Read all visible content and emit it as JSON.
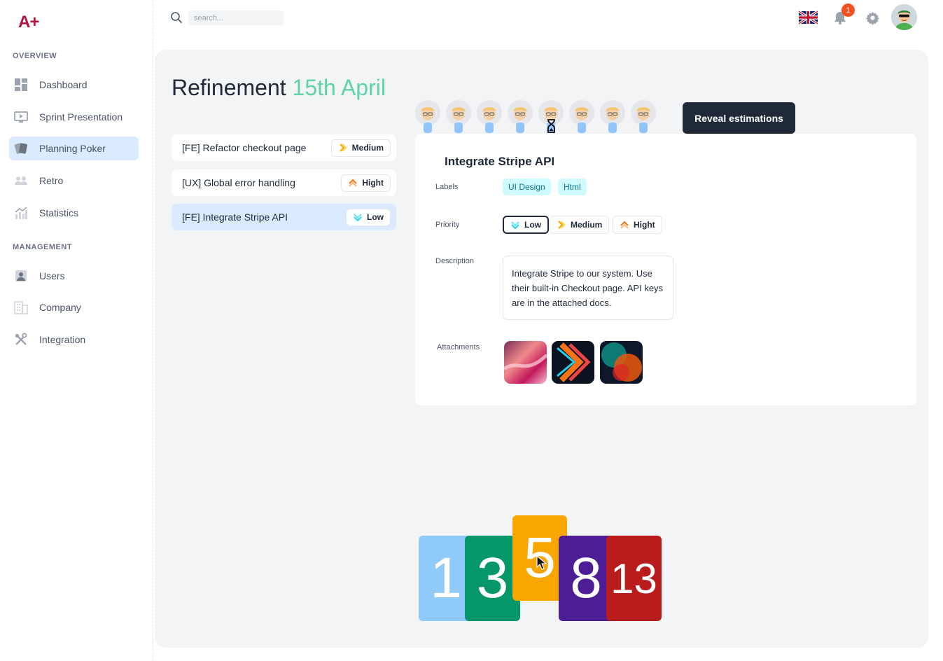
{
  "app": {
    "logo": "A+"
  },
  "sidebar": {
    "sections": [
      {
        "title": "OVERVIEW"
      },
      {
        "title": "MANAGEMENT"
      }
    ],
    "items": [
      {
        "label": "Dashboard",
        "icon": "dashboard-icon"
      },
      {
        "label": "Sprint Presentation",
        "icon": "presentation-icon"
      },
      {
        "label": "Planning Poker",
        "icon": "cards-icon",
        "active": true
      },
      {
        "label": "Retro",
        "icon": "people-icon"
      },
      {
        "label": "Statistics",
        "icon": "chart-icon"
      },
      {
        "label": "Users",
        "icon": "user-icon"
      },
      {
        "label": "Company",
        "icon": "building-icon"
      },
      {
        "label": "Integration",
        "icon": "tools-icon"
      }
    ]
  },
  "topbar": {
    "search_placeholder": "search...",
    "notification_count": "1",
    "language": "en-GB"
  },
  "page": {
    "title": "Refinement",
    "date": "15th April"
  },
  "tasks": [
    {
      "name": "[FE] Refactor checkout page",
      "priority": "Medium"
    },
    {
      "name": "[UX] Global error handling",
      "priority": "Hight"
    },
    {
      "name": "[FE] Integrate Stripe API",
      "priority": "Low",
      "selected": true
    }
  ],
  "voters": {
    "count": 8,
    "pending_index": 4
  },
  "reveal_button": "Reveal estimations",
  "detail": {
    "title": "Integrate Stripe API",
    "labels_label": "Labels",
    "labels": [
      "UI Design",
      "Html"
    ],
    "priority_label": "Priority",
    "priority_options": [
      "Low",
      "Medium",
      "Hight"
    ],
    "priority_selected": "Low",
    "description_label": "Description",
    "description": "Integrate Stripe to our system. Use their built-in Checkout page. API keys are in the attached docs.",
    "attachments_label": "Attachments",
    "attachments": 3
  },
  "cards": [
    "1",
    "3",
    "5",
    "8",
    "13"
  ],
  "colors": {
    "accent": "#5ed3a4",
    "brand": "#b5123e",
    "dark": "#1f2937",
    "card_1": "#90caf9",
    "card_3": "#059669",
    "card_5": "#f9a602",
    "card_8": "#4c1d95",
    "card_13": "#b91c1c"
  }
}
